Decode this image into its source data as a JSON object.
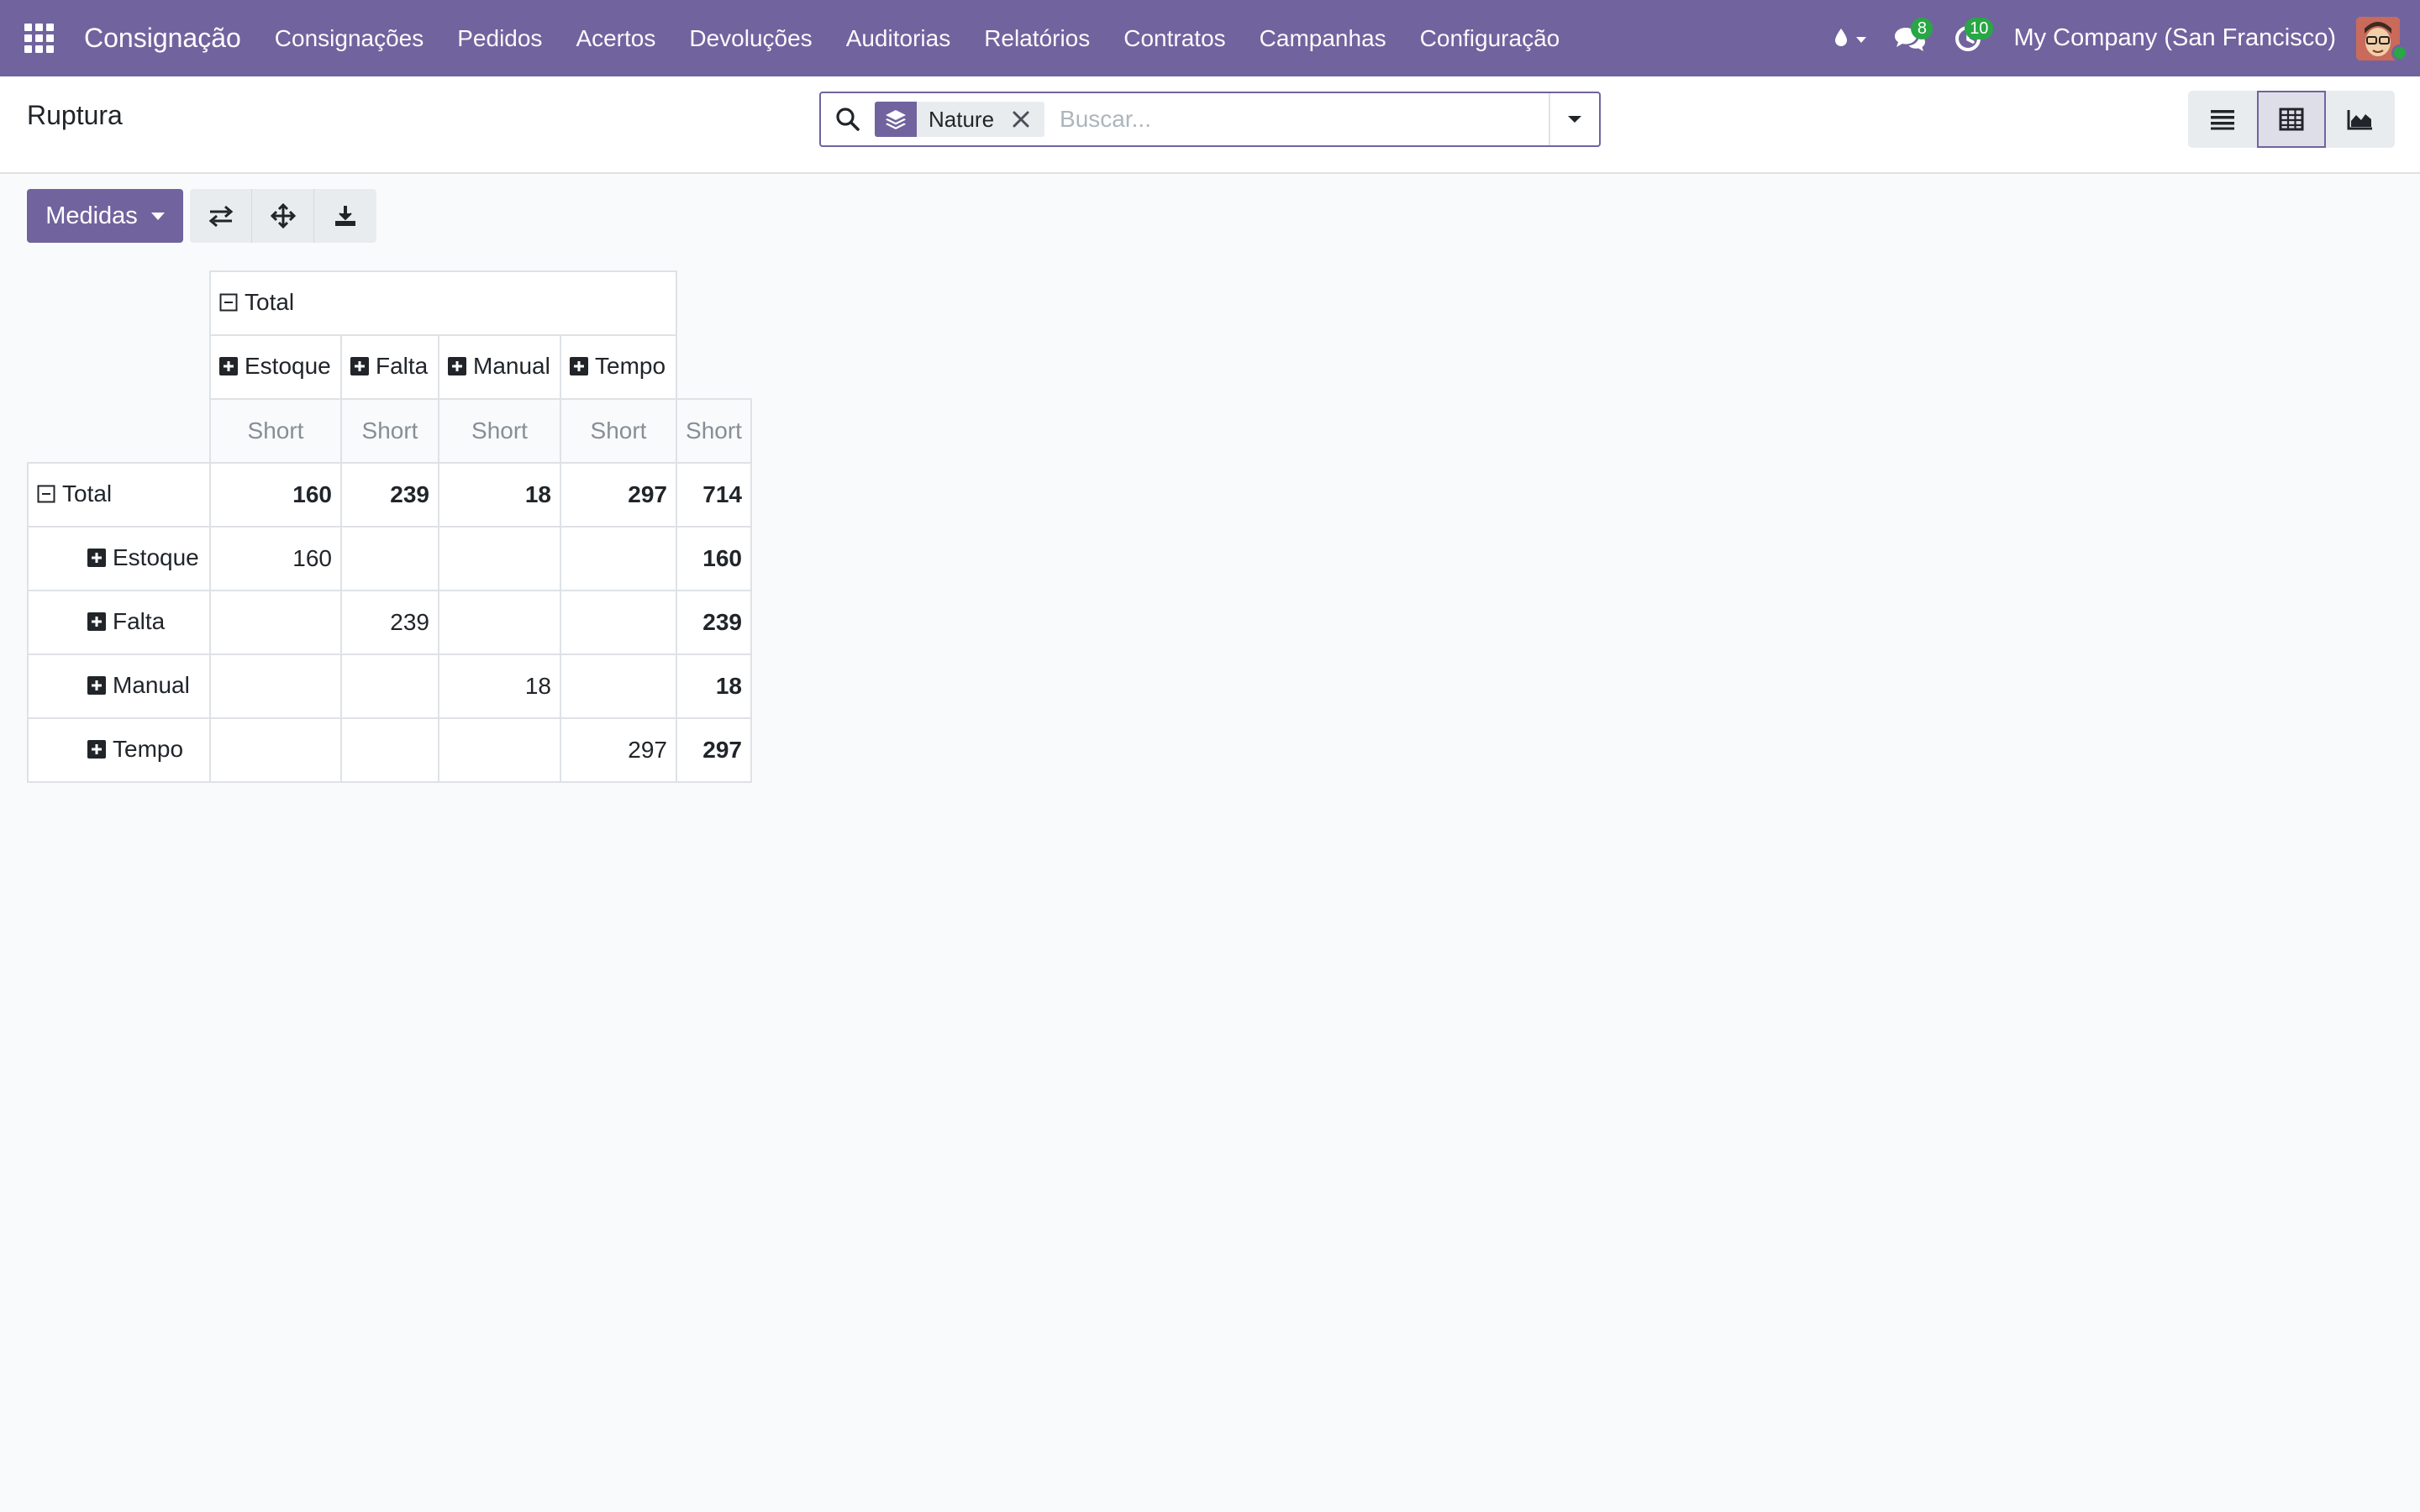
{
  "navbar": {
    "brand": "Consignação",
    "menu": [
      "Consignações",
      "Pedidos",
      "Acertos",
      "Devoluções",
      "Auditorias",
      "Relatórios",
      "Contratos",
      "Campanhas",
      "Configuração"
    ],
    "messages_count": "8",
    "activities_count": "10",
    "company": "My Company (San Francisco)",
    "color": "#71639e"
  },
  "control_panel": {
    "breadcrumb": "Ruptura",
    "search": {
      "facet_label": "Nature",
      "placeholder": "Buscar..."
    }
  },
  "toolbar": {
    "measures_label": "Medidas"
  },
  "pivot": {
    "col_total_label": "Total",
    "col_headers": [
      "Estoque",
      "Falta",
      "Manual",
      "Tempo"
    ],
    "measure_label": "Short",
    "row_total_label": "Total",
    "total_row": [
      "160",
      "239",
      "18",
      "297",
      "714"
    ],
    "rows": [
      {
        "label": "Estoque",
        "values": [
          "160",
          "",
          "",
          "",
          "160"
        ]
      },
      {
        "label": "Falta",
        "values": [
          "",
          "239",
          "",
          "",
          "239"
        ]
      },
      {
        "label": "Manual",
        "values": [
          "",
          "",
          "18",
          "",
          "18"
        ]
      },
      {
        "label": "Tempo",
        "values": [
          "",
          "",
          "",
          "297",
          "297"
        ]
      }
    ]
  }
}
